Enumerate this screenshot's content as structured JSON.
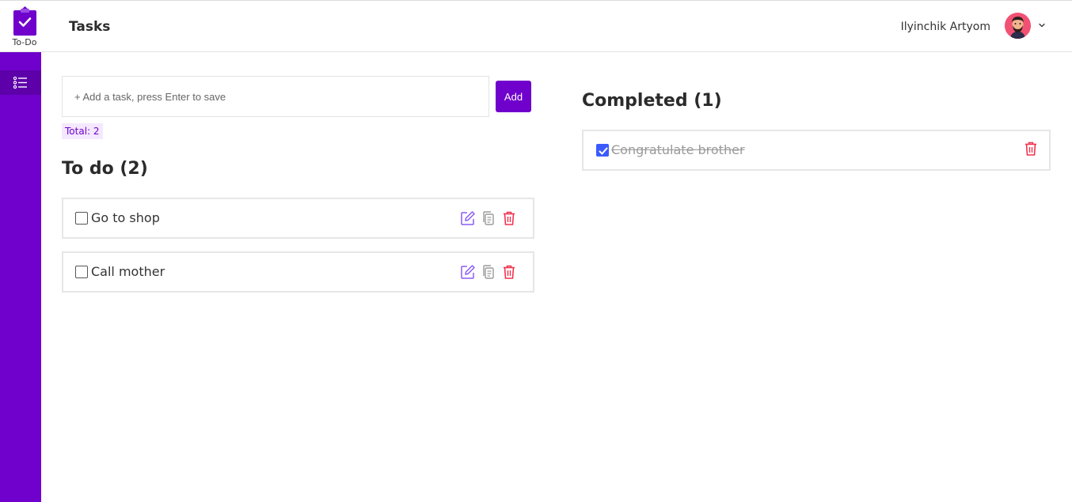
{
  "brand": {
    "name": "To-Do",
    "color": "#7001cc"
  },
  "header": {
    "title": "Tasks",
    "user_name": "Ilyinchik Artyom"
  },
  "sidebar": {
    "items": [
      {
        "icon": "list-icon",
        "active": true
      }
    ]
  },
  "input": {
    "placeholder": "+ Add a task, press Enter to save",
    "value": ""
  },
  "add_button": {
    "label": "Add"
  },
  "total": "Total: 2",
  "todo": {
    "title": "To do (2)",
    "tasks": [
      {
        "text": "Go to shop",
        "checked": false
      },
      {
        "text": "Call mother",
        "checked": false
      }
    ]
  },
  "completed": {
    "title": "Completed (1)",
    "tasks": [
      {
        "text": "Congratulate brother",
        "checked": true
      }
    ]
  },
  "colors": {
    "accent": "#7001cc",
    "edit": "#8a5cf6",
    "copy": "#9a9a9a",
    "delete": "#f0334f",
    "checkbox": "#3b5bfd"
  }
}
